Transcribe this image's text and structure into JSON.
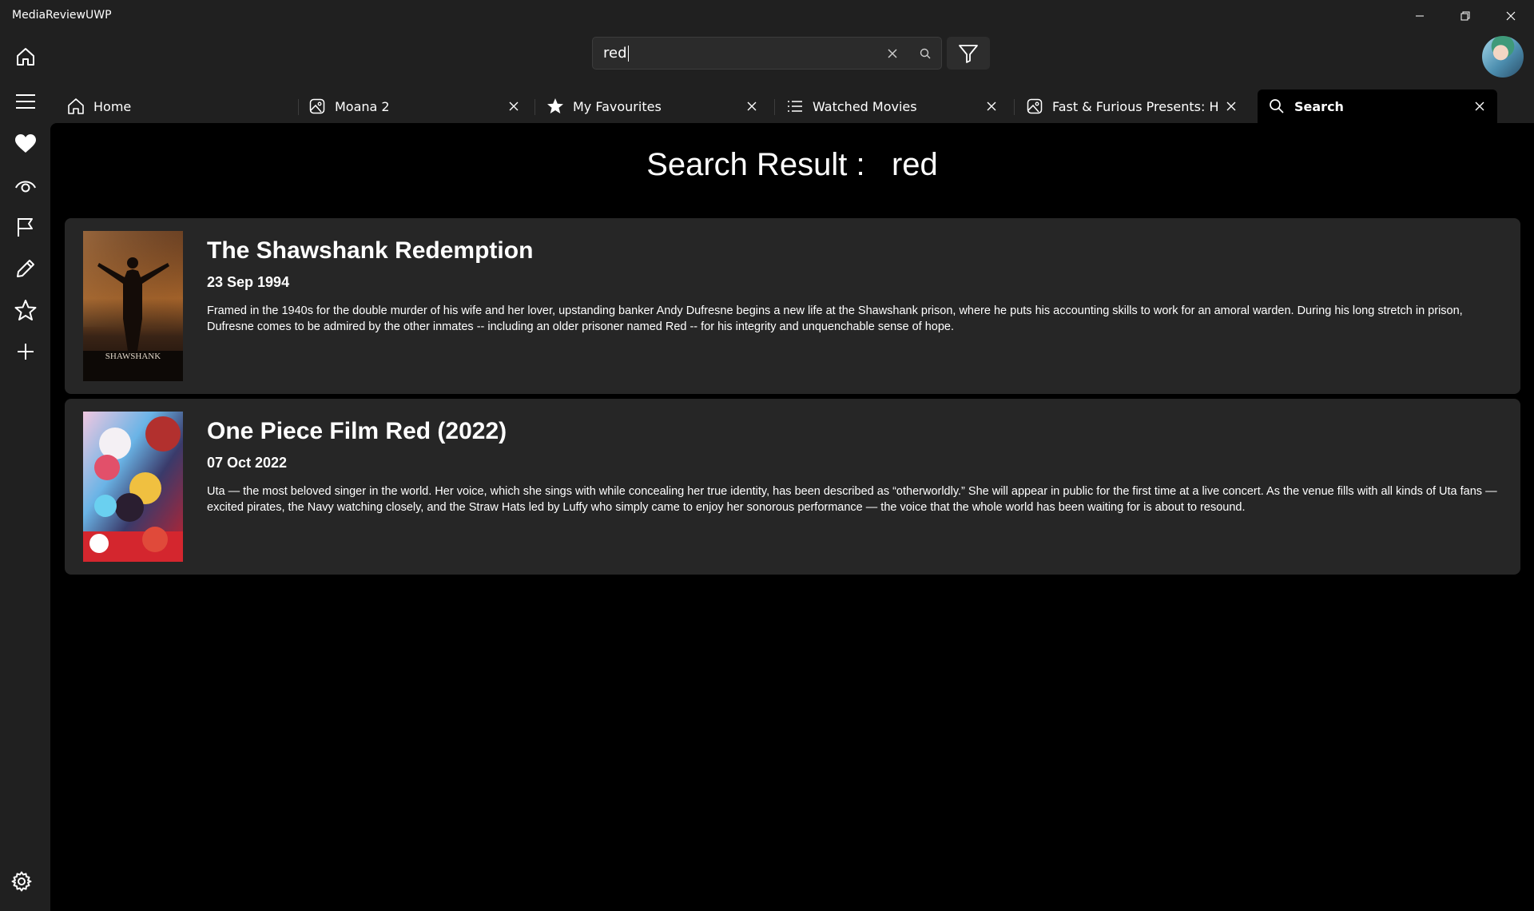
{
  "app": {
    "title": "MediaReviewUWP"
  },
  "search": {
    "value": "red"
  },
  "tabs": [
    {
      "label": "Home",
      "icon": "home-icon"
    },
    {
      "label": "Moana 2",
      "icon": "image-icon"
    },
    {
      "label": "My Favourites",
      "icon": "star-filled-icon"
    },
    {
      "label": "Watched Movies",
      "icon": "list-icon"
    },
    {
      "label": "Fast & Furious Presents: Hobbs",
      "icon": "image-icon"
    },
    {
      "label": "Search",
      "icon": "search-icon"
    }
  ],
  "nav": [
    {
      "icon": "home-icon"
    },
    {
      "icon": "menu-icon"
    },
    {
      "icon": "heart-icon"
    },
    {
      "icon": "eye-icon"
    },
    {
      "icon": "flag-icon"
    },
    {
      "icon": "pencil-icon"
    },
    {
      "icon": "star-icon"
    },
    {
      "icon": "plus-icon"
    },
    {
      "icon": "settings-icon"
    }
  ],
  "page": {
    "title": "Search Result :   red"
  },
  "results": [
    {
      "title": "The Shawshank Redemption",
      "date": "23 Sep 1994",
      "description": "Framed in the 1940s for the double murder of his wife and her lover, upstanding banker Andy Dufresne begins a new life at the Shawshank prison, where he puts his accounting skills to work for an amoral warden. During his long stretch in prison, Dufresne comes to be admired by the other inmates -- including an older prisoner named Red -- for his integrity and unquenchable sense of hope.",
      "poster_text": "SHAWSHANK"
    },
    {
      "title": "One Piece Film Red (2022)",
      "date": "07 Oct 2022",
      "description": "Uta — the most beloved singer in the world. Her voice, which she sings with while concealing her true identity, has been described as “otherworldly.” She will appear in public for the first time at a live concert. As the venue fills with all kinds of Uta fans — excited pirates, the Navy watching closely, and the Straw Hats led by Luffy who simply came to enjoy her sonorous performance — the voice that the whole world has been waiting for is about to resound."
    }
  ]
}
